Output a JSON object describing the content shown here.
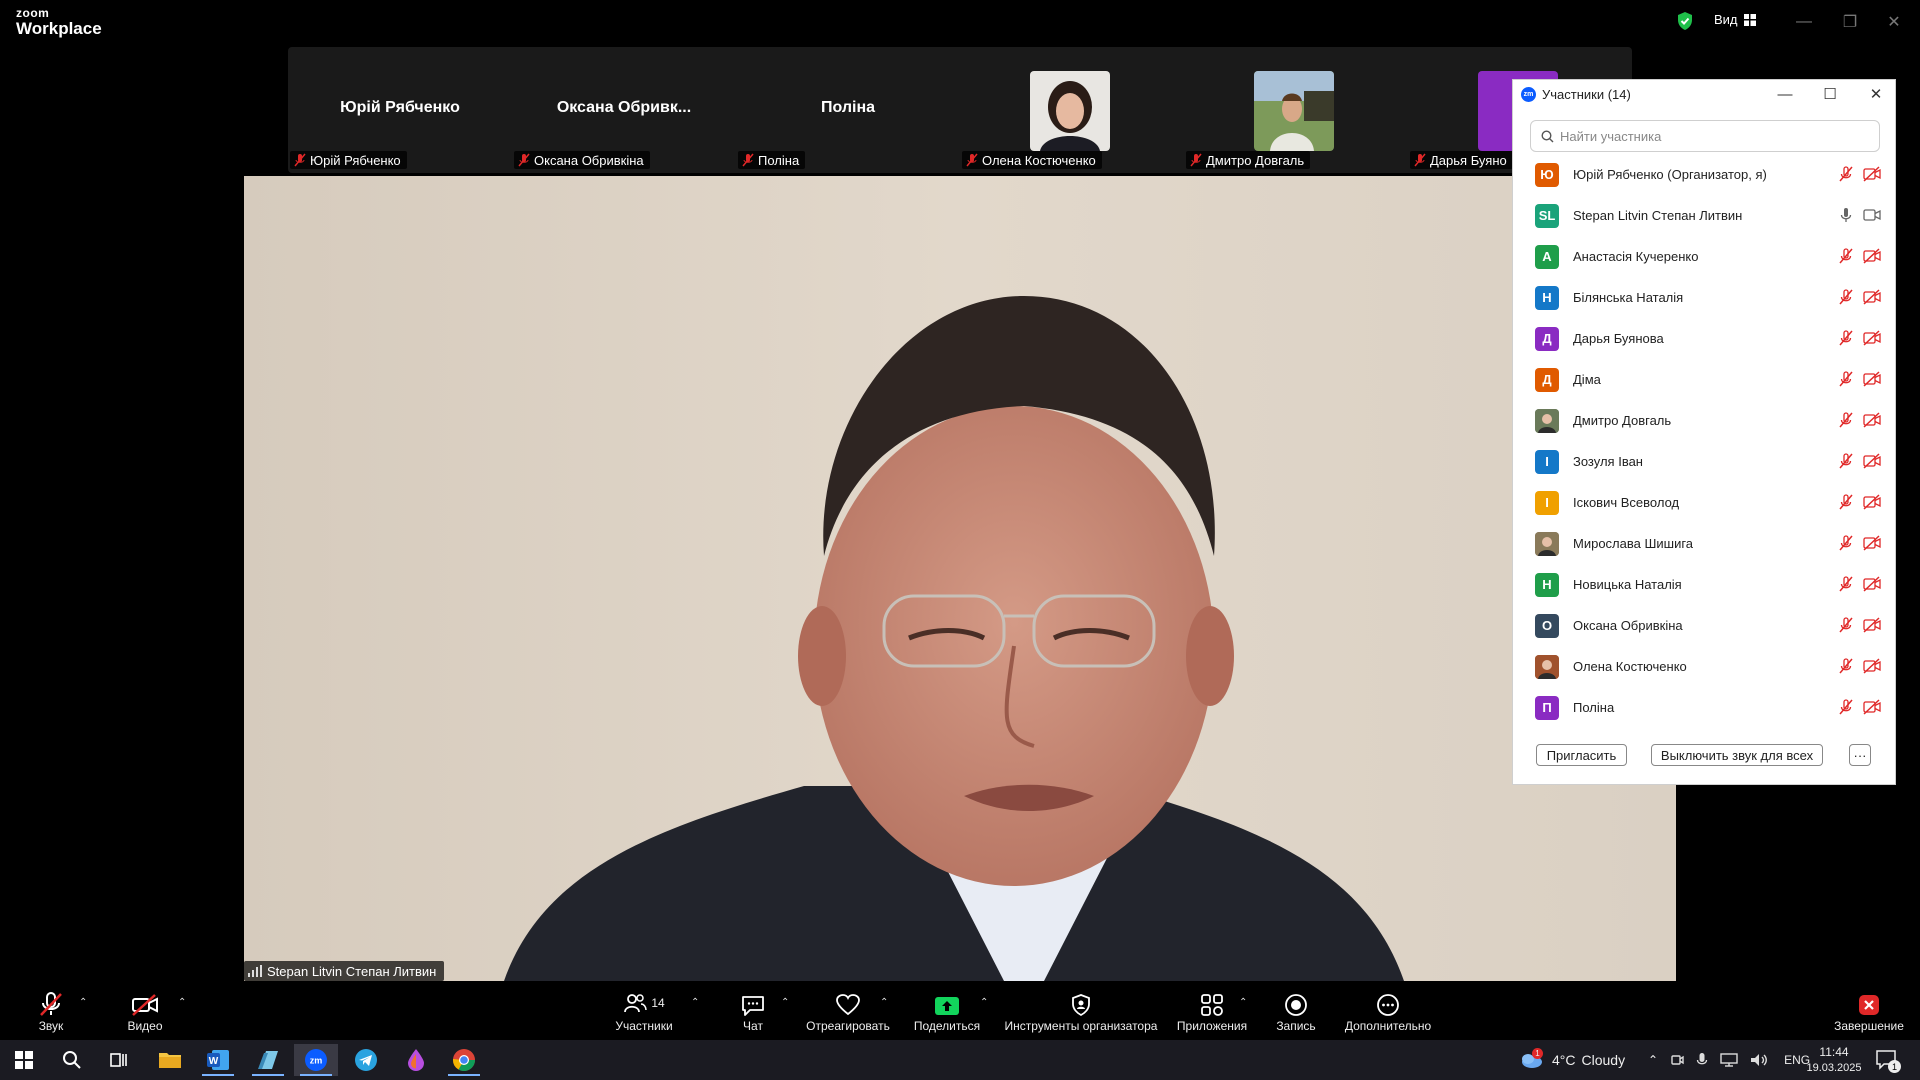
{
  "app": {
    "logo_top": "zoom",
    "logo_bottom": "Workplace",
    "view_label": "Вид"
  },
  "strip": {
    "tiles": [
      {
        "big_name": "Юрій Рябченко",
        "label": "Юрій Рябченко"
      },
      {
        "big_name": "Оксана  Обривк...",
        "label": "Оксана Обривкіна"
      },
      {
        "big_name": "Поліна",
        "label": "Поліна"
      },
      {
        "big_name": "",
        "label": "Олена Костюченко"
      },
      {
        "big_name": "",
        "label": "Дмитро Довгаль"
      },
      {
        "big_name": "",
        "label": "Дарья Буяно"
      }
    ]
  },
  "main_video": {
    "speaker_label": "Stepan Litvin Степан Литвин"
  },
  "participants_panel": {
    "title": "Участники (14)",
    "search_placeholder": "Найти участника",
    "participants": [
      {
        "initials": "Ю",
        "name": "Юрій Рябченко (Организатор, я)",
        "color": "#e05a00",
        "mic_on": false,
        "video_on": false
      },
      {
        "initials": "SL",
        "name": "Stepan Litvin Степан Литвин",
        "color": "#1aa37a",
        "mic_on": true,
        "video_on": true
      },
      {
        "initials": "А",
        "name": "Анастасія Кучеренко",
        "color": "#1f9e4a",
        "mic_on": false,
        "video_on": false
      },
      {
        "initials": "Н",
        "name": "Білянська Наталія",
        "color": "#1478c8",
        "mic_on": false,
        "video_on": false
      },
      {
        "initials": "Д",
        "name": "Дарья Буянова",
        "color": "#8a2bc2",
        "mic_on": false,
        "video_on": false
      },
      {
        "initials": "Д",
        "name": "Діма",
        "color": "#e05a00",
        "mic_on": false,
        "video_on": false
      },
      {
        "initials": "",
        "name": "Дмитро Довгаль",
        "color": "#6a7a5a",
        "mic_on": false,
        "video_on": false
      },
      {
        "initials": "І",
        "name": "Зозуля Іван",
        "color": "#1478c8",
        "mic_on": false,
        "video_on": false
      },
      {
        "initials": "І",
        "name": "Іскович Всеволод",
        "color": "#f0a000",
        "mic_on": false,
        "video_on": false
      },
      {
        "initials": "",
        "name": "Мирослава Шишига",
        "color": "#8a7a5a",
        "mic_on": false,
        "video_on": false
      },
      {
        "initials": "Н",
        "name": "Новицька Наталія",
        "color": "#1f9e4a",
        "mic_on": false,
        "video_on": false
      },
      {
        "initials": "О",
        "name": "Оксана Обривкіна",
        "color": "#34495e",
        "mic_on": false,
        "video_on": false
      },
      {
        "initials": "",
        "name": "Олена Костюченко",
        "color": "#a0522d",
        "mic_on": false,
        "video_on": false
      },
      {
        "initials": "П",
        "name": "Поліна",
        "color": "#8a2bc2",
        "mic_on": false,
        "video_on": false
      }
    ],
    "invite_label": "Пригласить",
    "mute_all_label": "Выключить звук для всех",
    "more_label": "···"
  },
  "toolbar": {
    "audio_label": "Звук",
    "video_label": "Видео",
    "participants_label": "Участники",
    "participants_count": "14",
    "chat_label": "Чат",
    "react_label": "Отреагировать",
    "share_label": "Поделиться",
    "host_tools_label": "Инструменты организатора",
    "apps_label": "Приложения",
    "record_label": "Запись",
    "more_label": "Дополнительно",
    "end_label": "Завершение"
  },
  "taskbar": {
    "weather_temp": "4°C",
    "weather_text": "Cloudy",
    "weather_badge": "1",
    "language": "ENG",
    "time": "11:44",
    "date": "19.03.2025",
    "notification_count": "1"
  },
  "colors": {
    "accent": "#0b5cff",
    "end_red": "#e02828",
    "mute_red": "#e02828",
    "share_green": "#12d45c"
  }
}
